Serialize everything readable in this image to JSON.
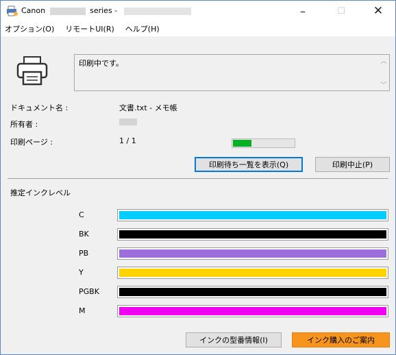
{
  "window": {
    "title_prefix": "Canon",
    "title_suffix": "series -",
    "minimize_glyph": "–",
    "maximize_glyph": "☐",
    "close_glyph": "✕"
  },
  "menu": {
    "items": [
      {
        "label": "オプション(O)"
      },
      {
        "label": "リモートUI(R)"
      },
      {
        "label": "ヘルプ(H)"
      }
    ]
  },
  "status": {
    "message": "印刷中です。"
  },
  "info": {
    "document_label": "ドキュメント名 :",
    "document_value": "文書.txt - メモ帳",
    "owner_label": "所有者 :",
    "pages_label": "印刷ページ :",
    "pages_value": "1 / 1",
    "progress_fraction": 0.3,
    "progress_color": "#06b025"
  },
  "buttons": {
    "show_queue": "印刷待ち一覧を表示(Q)",
    "cancel_print": "印刷中止(P)",
    "ink_model_info": "インクの型番情報(I)",
    "ink_purchase": "インク購入のご案内"
  },
  "ink": {
    "section_title": "推定インクレベル",
    "levels": [
      {
        "name": "C",
        "color": "#00ccff",
        "level": 1.0
      },
      {
        "name": "BK",
        "color": "#000000",
        "level": 1.0
      },
      {
        "name": "PB",
        "color": "#9b6fdc",
        "level": 1.0
      },
      {
        "name": "Y",
        "color": "#ffd200",
        "level": 1.0
      },
      {
        "name": "PGBK",
        "color": "#000000",
        "level": 1.0
      },
      {
        "name": "M",
        "color": "#f000f0",
        "level": 1.0
      }
    ]
  },
  "colors": {
    "accent": "#0078d7",
    "purchase_button": "#f7941d"
  }
}
